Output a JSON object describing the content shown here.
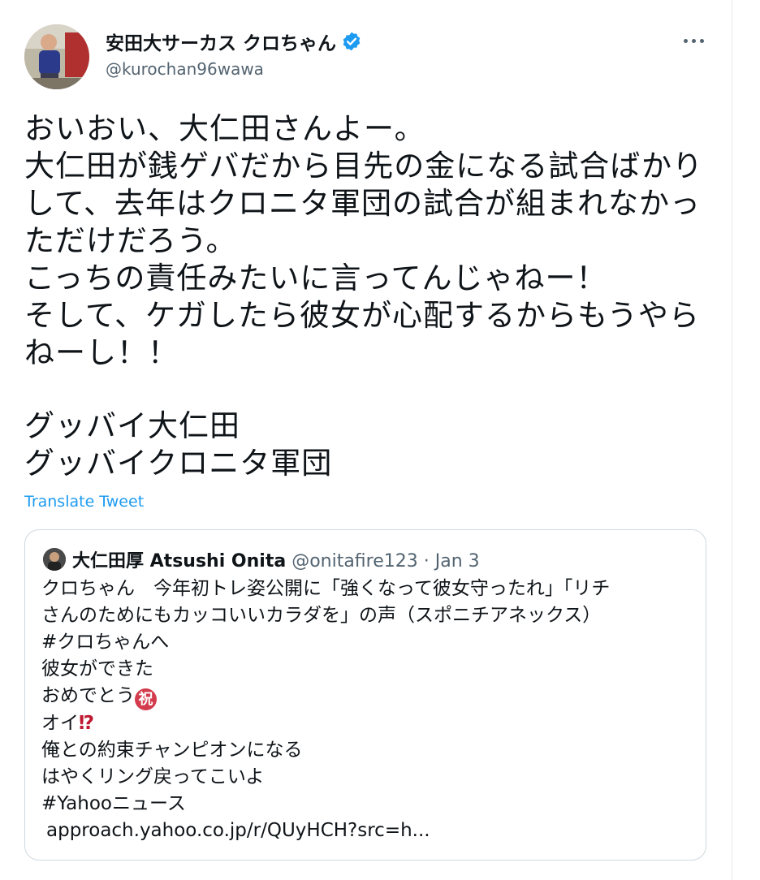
{
  "author": {
    "display_name": "安田大サーカス クロちゃん",
    "handle": "@kurochan96wawa",
    "avatar_icon": "avatar-photo",
    "verified_icon": "verified-badge-icon",
    "verified_color": "#1d9bf0"
  },
  "more_icon": "more-options-icon",
  "tweet": {
    "lines": [
      "おいおい、大仁田さんよー。",
      "大仁田が銭ゲバだから目先の金になる試合ばかり",
      "して、去年はクロニタ軍団の試合が組まれなかっ",
      "ただけだろう。",
      "こっちの責任みたいに言ってんじゃねー！",
      "そして、ケガしたら彼女が心配するからもうやら",
      "ねーし！！",
      "グッバイ大仁田",
      "グッバイクロニタ軍団"
    ],
    "translate_label": "Translate Tweet",
    "link_color": "#1d9bf0"
  },
  "quote": {
    "name": "大仁田厚 Atsushi Onita",
    "handle": "@onitafire123",
    "separator": "·",
    "date": "Jan 3",
    "lines": [
      "クロちゃん　今年初トレ姿公開に「強くなって彼女守ったれ」「リチ",
      "さんのためにもカッコいいカラダを」の声（スポニチアネックス）",
      "#クロちゃんへ",
      "彼女ができた",
      "おめでとう",
      "オイ",
      "俺との約束チャンピオンになる",
      "はやくリング戻ってこいよ",
      "#Yahooニュース"
    ],
    "congrats_emoji": "祝",
    "exclaim_emoji": "⁉",
    "link": "approach.yahoo.co.jp/r/QUyHCH?src=h..."
  }
}
